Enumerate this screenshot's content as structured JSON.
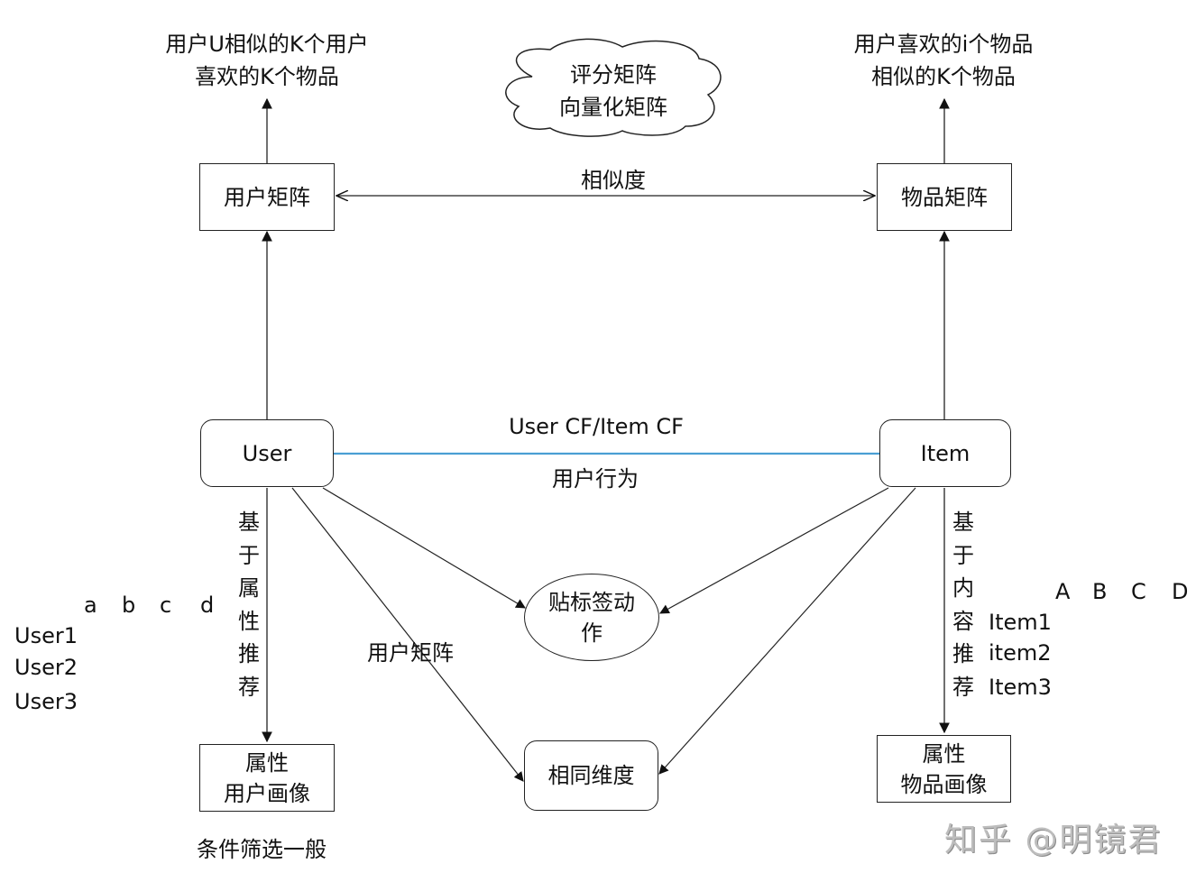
{
  "diagram": {
    "top_left_label": [
      "用户U相似的K个用户",
      "喜欢的K个物品"
    ],
    "cloud_label": [
      "评分矩阵",
      "向量化矩阵"
    ],
    "top_right_label": [
      "用户喜欢的i个物品",
      "相似的K个物品"
    ],
    "user_matrix_node": "用户矩阵",
    "item_matrix_node": "物品矩阵",
    "similarity_label": "相似度",
    "user_node": "User",
    "item_node": "Item",
    "cf_label": "User CF/Item CF",
    "behavior_label": "用户行为",
    "attr_rec_label": [
      "基",
      "于",
      "属",
      "性",
      "推",
      "荐"
    ],
    "content_rec_label": [
      "基",
      "于",
      "内",
      "容",
      "推",
      "荐"
    ],
    "tag_node": [
      "贴标签动",
      "作"
    ],
    "user_matrix_label_mid": "用户矩阵",
    "same_dim_node": "相同维度",
    "user_profile_node": [
      "属性",
      "用户画像"
    ],
    "item_profile_node": [
      "属性",
      "物品画像"
    ],
    "filter_label": "条件筛选一般",
    "user_table": {
      "columns": [
        "a",
        "b",
        "c",
        "d"
      ],
      "rows": [
        "User1",
        "User2",
        "User3"
      ]
    },
    "item_table": {
      "columns": [
        "A",
        "B",
        "C",
        "D"
      ],
      "rows": [
        "Item1",
        "item2",
        "Item3"
      ]
    },
    "watermark": "知乎 @明镜君",
    "colors": {
      "cf_line": "#4a9fd4",
      "stroke": "#222222"
    }
  }
}
